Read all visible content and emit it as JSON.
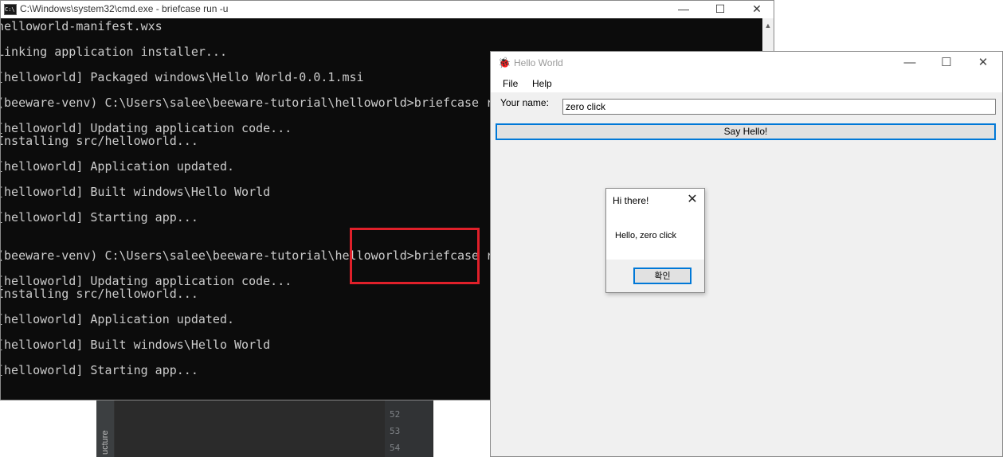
{
  "cmd": {
    "title": "C:\\Windows\\system32\\cmd.exe - briefcase  run -u",
    "controls": {
      "minimize": "—",
      "maximize": "☐",
      "close": "✕"
    },
    "lines": [
      "helloworld-manifest.wxs",
      "Linking application installer...",
      "[helloworld] Packaged windows\\Hello World-0.0.1.msi",
      "(beeware-venv) C:\\Users\\salee\\beeware-tutorial\\helloworld>briefcase run -u",
      "[helloworld] Updating application code...",
      "Installing src/helloworld...",
      "[helloworld] Application updated.",
      "[helloworld] Built windows\\Hello World",
      "[helloworld] Starting app...",
      "(beeware-venv) C:\\Users\\salee\\beeware-tutorial\\helloworld>briefcase run -u",
      "[helloworld] Updating application code...",
      "Installing src/helloworld...",
      "[helloworld] Application updated.",
      "[helloworld] Built windows\\Hello World",
      "[helloworld] Starting app..."
    ]
  },
  "ide": {
    "sidebar_label": "ucture",
    "line_numbers": [
      "52",
      "53",
      "54"
    ]
  },
  "app": {
    "title": "Hello World",
    "controls": {
      "minimize": "—",
      "maximize": "☐",
      "close": "✕"
    },
    "menu": {
      "file": "File",
      "help": "Help"
    },
    "name_label": "Your name:",
    "name_value": "zero click",
    "say_hello_label": "Say Hello!"
  },
  "dialog": {
    "title": "Hi there!",
    "message": "Hello, zero click",
    "ok_label": "확인",
    "close": "✕"
  },
  "colors": {
    "highlight": "#e0202a",
    "focus_border": "#0078d7",
    "terminal_bg": "#0c0c0c",
    "terminal_text": "#cccccc"
  }
}
